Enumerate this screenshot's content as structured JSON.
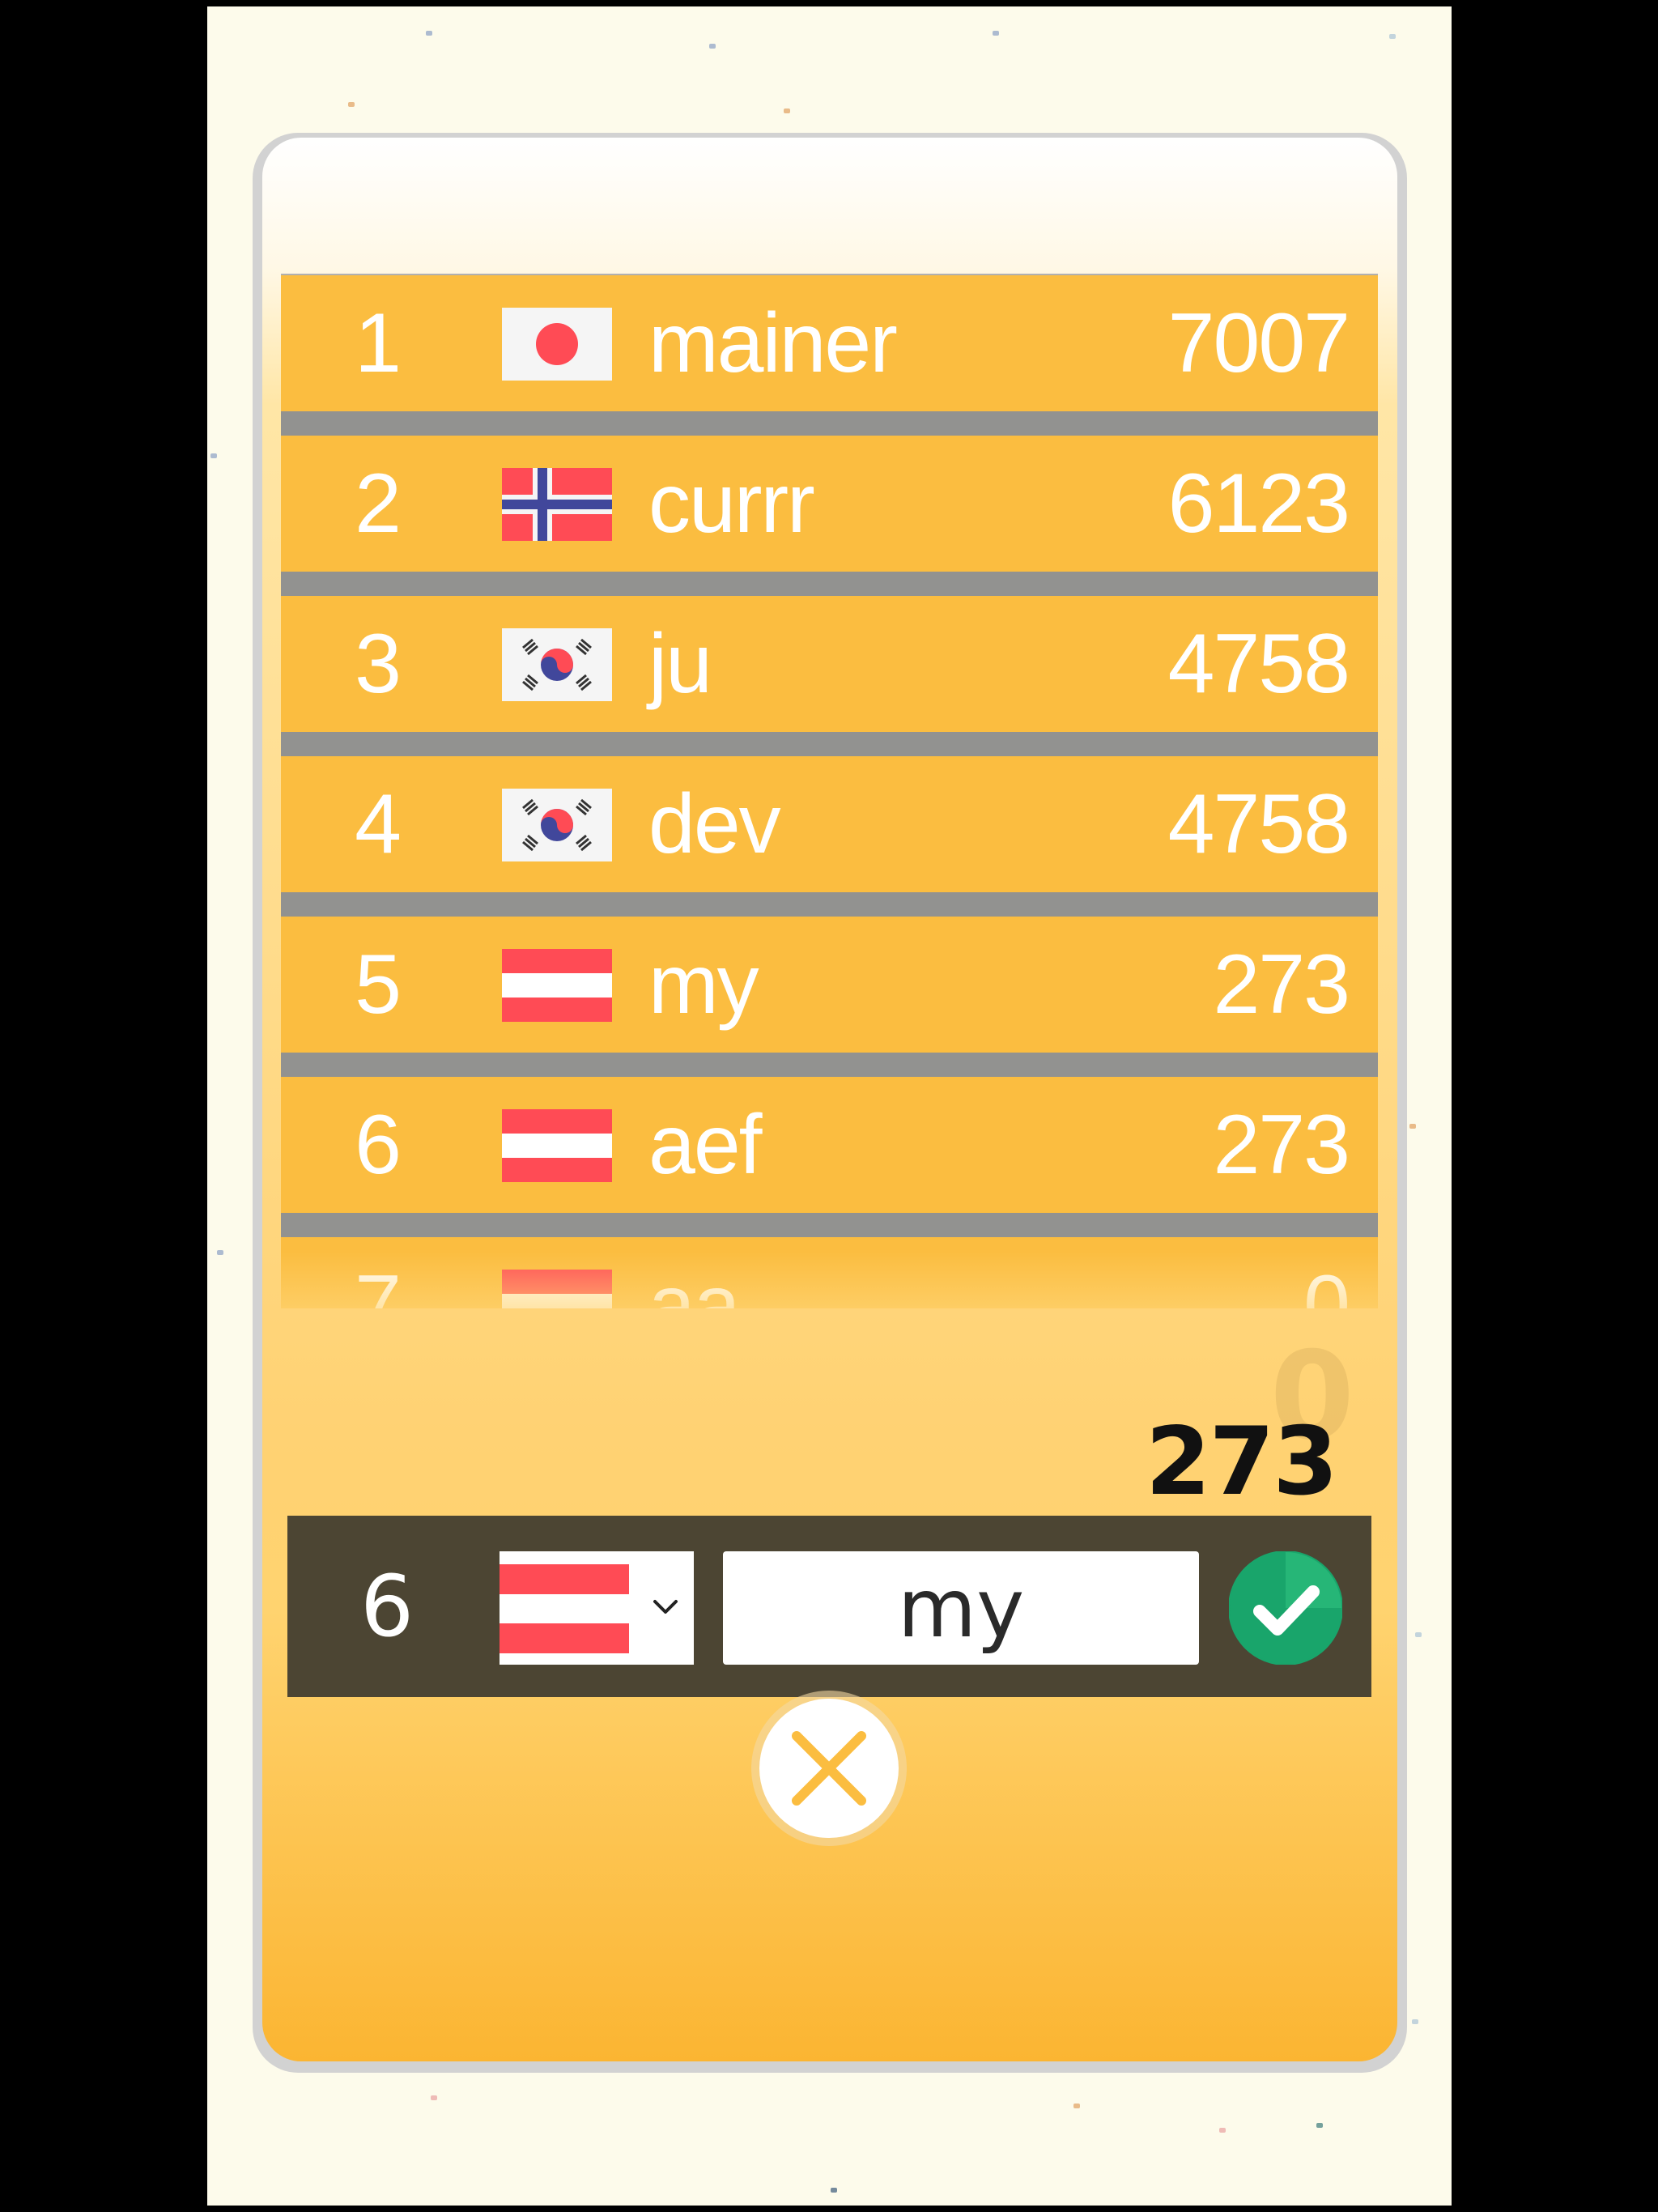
{
  "leaderboard": {
    "rows": [
      {
        "rank": "1",
        "flag": "japan-flag-icon",
        "name": "mainer",
        "score": "7007"
      },
      {
        "rank": "2",
        "flag": "norway-flag-icon",
        "name": "currr",
        "score": "6123"
      },
      {
        "rank": "3",
        "flag": "south-korea-flag-icon",
        "name": "ju",
        "score": "4758"
      },
      {
        "rank": "4",
        "flag": "south-korea-flag-icon",
        "name": "dev",
        "score": "4758"
      },
      {
        "rank": "5",
        "flag": "austria-flag-icon",
        "name": "my",
        "score": "273"
      },
      {
        "rank": "6",
        "flag": "austria-flag-icon",
        "name": "aef",
        "score": "273"
      },
      {
        "rank": "7",
        "flag": "austria-flag-icon",
        "name": "aa",
        "score": "0"
      }
    ]
  },
  "score": {
    "previous": "0",
    "current": "273"
  },
  "entry": {
    "rank": "6",
    "country_flag": "austria-flag-icon",
    "name_value": "my",
    "confirm_icon": "check-circle-icon"
  },
  "close_icon": "close-x-icon",
  "colors": {
    "row_background": "#fbbd40",
    "row_separator": "#929290",
    "entry_bar": "#4c4533",
    "confirm_green": "#19a56b",
    "panel_bottom": "#fbb532"
  }
}
